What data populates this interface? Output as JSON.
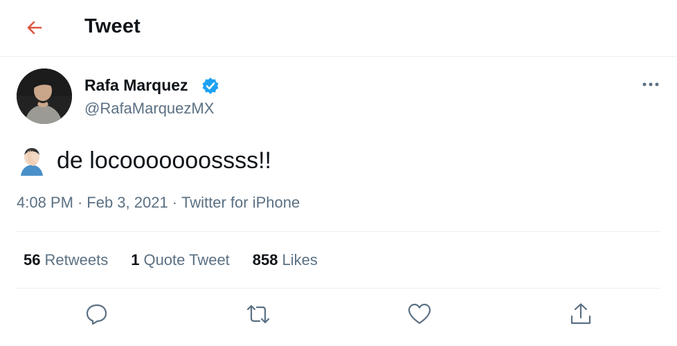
{
  "header": {
    "title": "Tweet",
    "back_icon": "arrow-left-icon",
    "accent_color": "#e0533d"
  },
  "tweet": {
    "author_name": "Rafa Marquez",
    "author_handle": "@RafaMarquezMX",
    "verified": true,
    "text": "de locooooooossss!!",
    "emoji": "facepalm-emoji",
    "time": "4:08 PM",
    "date": "Feb 3, 2021",
    "source": "Twitter for iPhone"
  },
  "stats": {
    "retweets_count": "56",
    "retweets_label": "Retweets",
    "quotes_count": "1",
    "quotes_label": "Quote Tweet",
    "likes_count": "858",
    "likes_label": "Likes"
  },
  "actions": {
    "reply_icon": "reply-icon",
    "retweet_icon": "retweet-icon",
    "like_icon": "heart-icon",
    "share_icon": "share-icon"
  },
  "colors": {
    "verified": "#1da1f2",
    "secondary_text": "#5b7083",
    "divider": "#eceef0"
  }
}
